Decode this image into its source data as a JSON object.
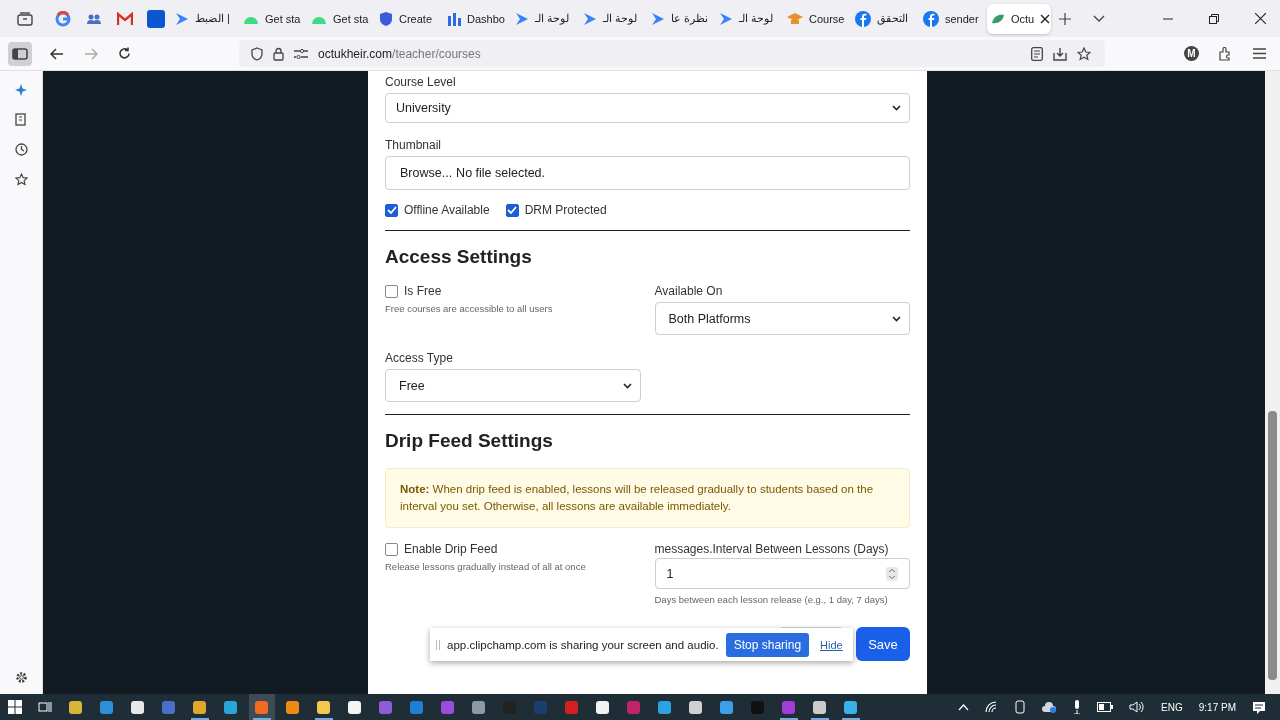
{
  "browser": {
    "tabs": [
      {
        "kind": "google",
        "selected": false
      },
      {
        "kind": "people",
        "selected": false
      },
      {
        "kind": "gmail",
        "selected": false
      },
      {
        "kind": "square",
        "selected": false
      },
      {
        "kind": "arrow",
        "title": "الضبط |",
        "selected": false
      },
      {
        "kind": "android",
        "title": "Get sta",
        "selected": false
      },
      {
        "kind": "android",
        "title": "Get sta",
        "selected": false
      },
      {
        "kind": "shield",
        "title": "Create",
        "selected": false
      },
      {
        "kind": "bars",
        "title": "Dashbo",
        "selected": false
      },
      {
        "kind": "arrow",
        "title": "لوحة الـ",
        "selected": false
      },
      {
        "kind": "arrow",
        "title": "لوحة الـ",
        "selected": false
      },
      {
        "kind": "arrow",
        "title": "نظرة عا",
        "selected": false
      },
      {
        "kind": "arrow",
        "title": "لوحة الـ",
        "selected": false
      },
      {
        "kind": "course",
        "title": "Course",
        "selected": false
      },
      {
        "kind": "facebook",
        "title": "التحقق",
        "selected": false
      },
      {
        "kind": "facebook",
        "title": "sender",
        "selected": false
      },
      {
        "kind": "leaf",
        "title": "Octu",
        "selected": true
      }
    ],
    "address": {
      "host": "octukheir.com",
      "path": "/teacher/courses"
    },
    "profile": "M"
  },
  "form": {
    "course_level": {
      "label": "Course Level",
      "value": "University"
    },
    "thumbnail": {
      "label": "Thumbnail",
      "button": "Browse...",
      "status": "No file selected."
    },
    "options": [
      {
        "label": "Offline Available",
        "checked": true
      },
      {
        "label": "DRM Protected",
        "checked": true
      }
    ],
    "access": {
      "heading": "Access Settings",
      "is_free": {
        "label": "Is Free",
        "checked": false,
        "help": "Free courses are accessible to all users"
      },
      "available_on": {
        "label": "Available On",
        "value": "Both Platforms"
      },
      "access_type": {
        "label": "Access Type",
        "value": "Free"
      }
    },
    "drip": {
      "heading": "Drip Feed Settings",
      "note": "**Note:** When drip feed is enabled, lessons will be released gradually to students based on the interval you set. Otherwise, all lessons are available immediately.",
      "enable": {
        "label": "Enable Drip Feed",
        "checked": false,
        "help": "Release lessons gradually instead of all at once"
      },
      "interval": {
        "label": "messages.Interval Between Lessons (Days)",
        "value": "1",
        "help": "Days between each lesson release (e.g., 1 day, 7 days)"
      }
    },
    "save": "Save"
  },
  "share_bar": {
    "message": "app.clipchamp.com is sharing your screen and audio.",
    "stop": "Stop sharing",
    "hide": "Hide"
  },
  "taskbar": {
    "apps": [
      {
        "color": "#d8b43a",
        "running": false,
        "selected": false
      },
      {
        "color": "#2f8fd8",
        "running": false,
        "selected": false
      },
      {
        "color": "#e8e8e8",
        "running": false,
        "selected": false
      },
      {
        "color": "#4a6fc9",
        "running": false,
        "selected": false
      },
      {
        "color": "#e0a82e",
        "running": true,
        "selected": false
      },
      {
        "color": "#2aa5d8",
        "running": false,
        "selected": false
      },
      {
        "color": "#f26b21",
        "running": true,
        "selected": true
      },
      {
        "color": "#f08a10",
        "running": false,
        "selected": false
      },
      {
        "color": "#f2c94c",
        "running": true,
        "selected": false
      },
      {
        "color": "#f5f5f5",
        "running": false,
        "selected": false
      },
      {
        "color": "#8e5cd9",
        "running": false,
        "selected": false
      },
      {
        "color": "#1f7fd8",
        "running": false,
        "selected": false
      },
      {
        "color": "#9b4ce0",
        "running": false,
        "selected": false
      },
      {
        "color": "#8a9aa8",
        "running": false,
        "selected": false
      },
      {
        "color": "#222222",
        "running": false,
        "selected": false
      },
      {
        "color": "#1c3d6e",
        "running": false,
        "selected": false
      },
      {
        "color": "#d42020",
        "running": false,
        "selected": false
      },
      {
        "color": "#f2f2f2",
        "running": false,
        "selected": false
      },
      {
        "color": "#c0246a",
        "running": false,
        "selected": false
      },
      {
        "color": "#2aa3e0",
        "running": false,
        "selected": false
      },
      {
        "color": "#d0d0d0",
        "running": false,
        "selected": false
      },
      {
        "color": "#3aa0e8",
        "running": false,
        "selected": false
      },
      {
        "color": "#111111",
        "running": false,
        "selected": false
      },
      {
        "color": "#a03cd8",
        "running": true,
        "selected": false
      },
      {
        "color": "#cccccc",
        "running": true,
        "selected": false
      },
      {
        "color": "#3ab0e8",
        "running": true,
        "selected": false
      }
    ],
    "language": "ENG",
    "time": "9:17 PM"
  }
}
